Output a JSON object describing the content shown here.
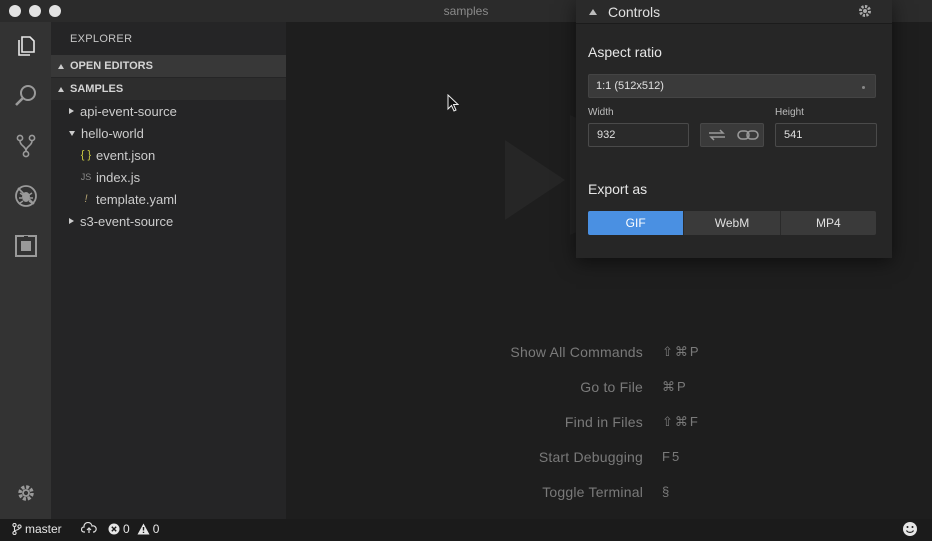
{
  "window": {
    "title": "samples"
  },
  "activity_bar": {
    "items": [
      "files-icon",
      "search-icon",
      "source-control-icon",
      "debug-icon",
      "extensions-icon",
      "settings-gear-icon"
    ]
  },
  "sidebar": {
    "title": "EXPLORER",
    "sections": {
      "open_editors": "OPEN EDITORS",
      "samples": "SAMPLES"
    },
    "tree": [
      {
        "label": "api-event-source",
        "type": "folder",
        "expanded": false
      },
      {
        "label": "hello-world",
        "type": "folder",
        "expanded": true
      },
      {
        "label": "event.json",
        "type": "file",
        "icon": "{ }"
      },
      {
        "label": "index.js",
        "type": "file",
        "icon": "JS"
      },
      {
        "label": "template.yaml",
        "type": "file",
        "icon": "!"
      },
      {
        "label": "s3-event-source",
        "type": "folder",
        "expanded": false
      }
    ]
  },
  "editor": {
    "commands": [
      {
        "label": "Show All Commands",
        "key": "⇧⌘P"
      },
      {
        "label": "Go to File",
        "key": "⌘P"
      },
      {
        "label": "Find in Files",
        "key": "⇧⌘F"
      },
      {
        "label": "Start Debugging",
        "key": "F5"
      },
      {
        "label": "Toggle Terminal",
        "key": "§"
      }
    ]
  },
  "controls": {
    "title": "Controls",
    "aspect_ratio_label": "Aspect ratio",
    "aspect_ratio_value": "1:1 (512x512)",
    "width_label": "Width",
    "width_value": "932",
    "height_label": "Height",
    "height_value": "541",
    "export_label": "Export as",
    "formats": [
      "GIF",
      "WebM",
      "MP4"
    ],
    "active_format": "GIF"
  },
  "statusbar": {
    "branch": "master",
    "errors": "0",
    "warnings": "0"
  },
  "colors": {
    "accent": "#4a90e2",
    "background": "#1e1e1e",
    "sidebar": "#252526",
    "activitybar": "#333333"
  }
}
